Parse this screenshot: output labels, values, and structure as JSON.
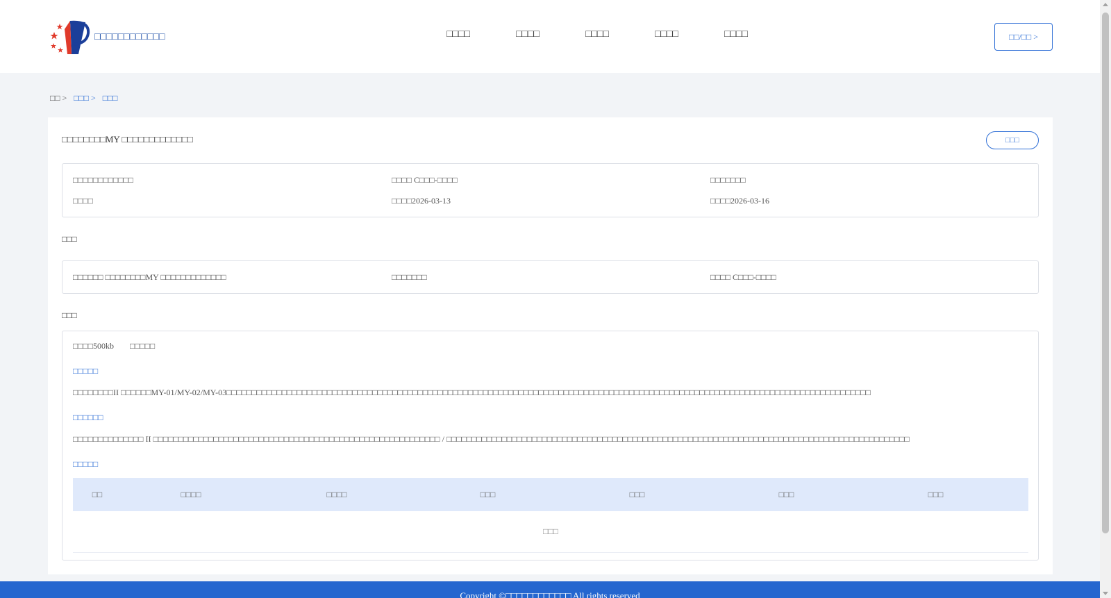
{
  "header": {
    "site_name": "□□□□□□□□□□□□",
    "nav": [
      "□□□□",
      "□□□□",
      "□□□□",
      "□□□□",
      "□□□□"
    ],
    "login_label": "□□/□□ >",
    "logo_icon": "national-emblem-logo"
  },
  "breadcrumb": [
    {
      "label": "□□ >"
    },
    {
      "label": "□□□ >"
    },
    {
      "label": "□□□"
    }
  ],
  "detail": {
    "title": "□□□□□□□□MY □□□□□□□□□□□□□",
    "back_label": "□□□",
    "info": {
      "r1c1": "□□□□□□□□□□□□",
      "r1c2": "□□□□ C□□□-□□□□",
      "r1c3": "□□□□□□□",
      "r2c1": "□□□□",
      "r2c2": "□□□□2026-03-13",
      "r2c3": "□□□□2026-03-16"
    },
    "section2_label": "□□□",
    "section2": {
      "c1": "□□□□□□ □□□□□□□□MY □□□□□□□□□□□□□",
      "c2": "□□□□□□□",
      "c3": "□□□□ C□□□-□□□□"
    },
    "section3_label": "□□□",
    "section3": {
      "meta1": "□□□□500kb",
      "meta2": "□□□□□",
      "sub1": "□□□□□",
      "para1": "□□□□□□□□II □□□□□□MY-01/MY-02/MY-03□□□□□□□□□□□□□□□□□□□□□□□□□□□□□□□□□□□□□□□□□□□□□□□□□□□□□□□□□□□□□□□□□□□□□□□□□□□□□□□□□□□□□□□□□□□□□□□□□□□□□□□□□□□□□□□□□□□□□□□□□□□□□□□□",
      "sub2": "□□□□□□",
      "para2": "□□□□□□□□□□□□□□ II □□□□□□□□□□□□□□□□□□□□□□□□□□□□□□□□□□□□□□□□□□□□□□□□□□□□□□□□□ / □□□□□□□□□□□□□□□□□□□□□□□□□□□□□□□□□□□□□□□□□□□□□□□□□□□□□□□□□□□□□□□□□□□□□□□□□□□□□□□□□□□□□□□□□□□□",
      "sub3": "□□□□□",
      "table_headers": [
        "□□",
        "□□□□",
        "□□□□",
        "□□□",
        "□□□",
        "□□□",
        "□□□"
      ],
      "empty_text": "□□□"
    }
  },
  "footer": {
    "text": "Copyright ©□□□□□□□□□□□□ All rights reserved"
  },
  "colors": {
    "accent": "#2f6fd6",
    "footer_bg": "#2566cf",
    "table_head_bg": "#dfe9fb"
  }
}
